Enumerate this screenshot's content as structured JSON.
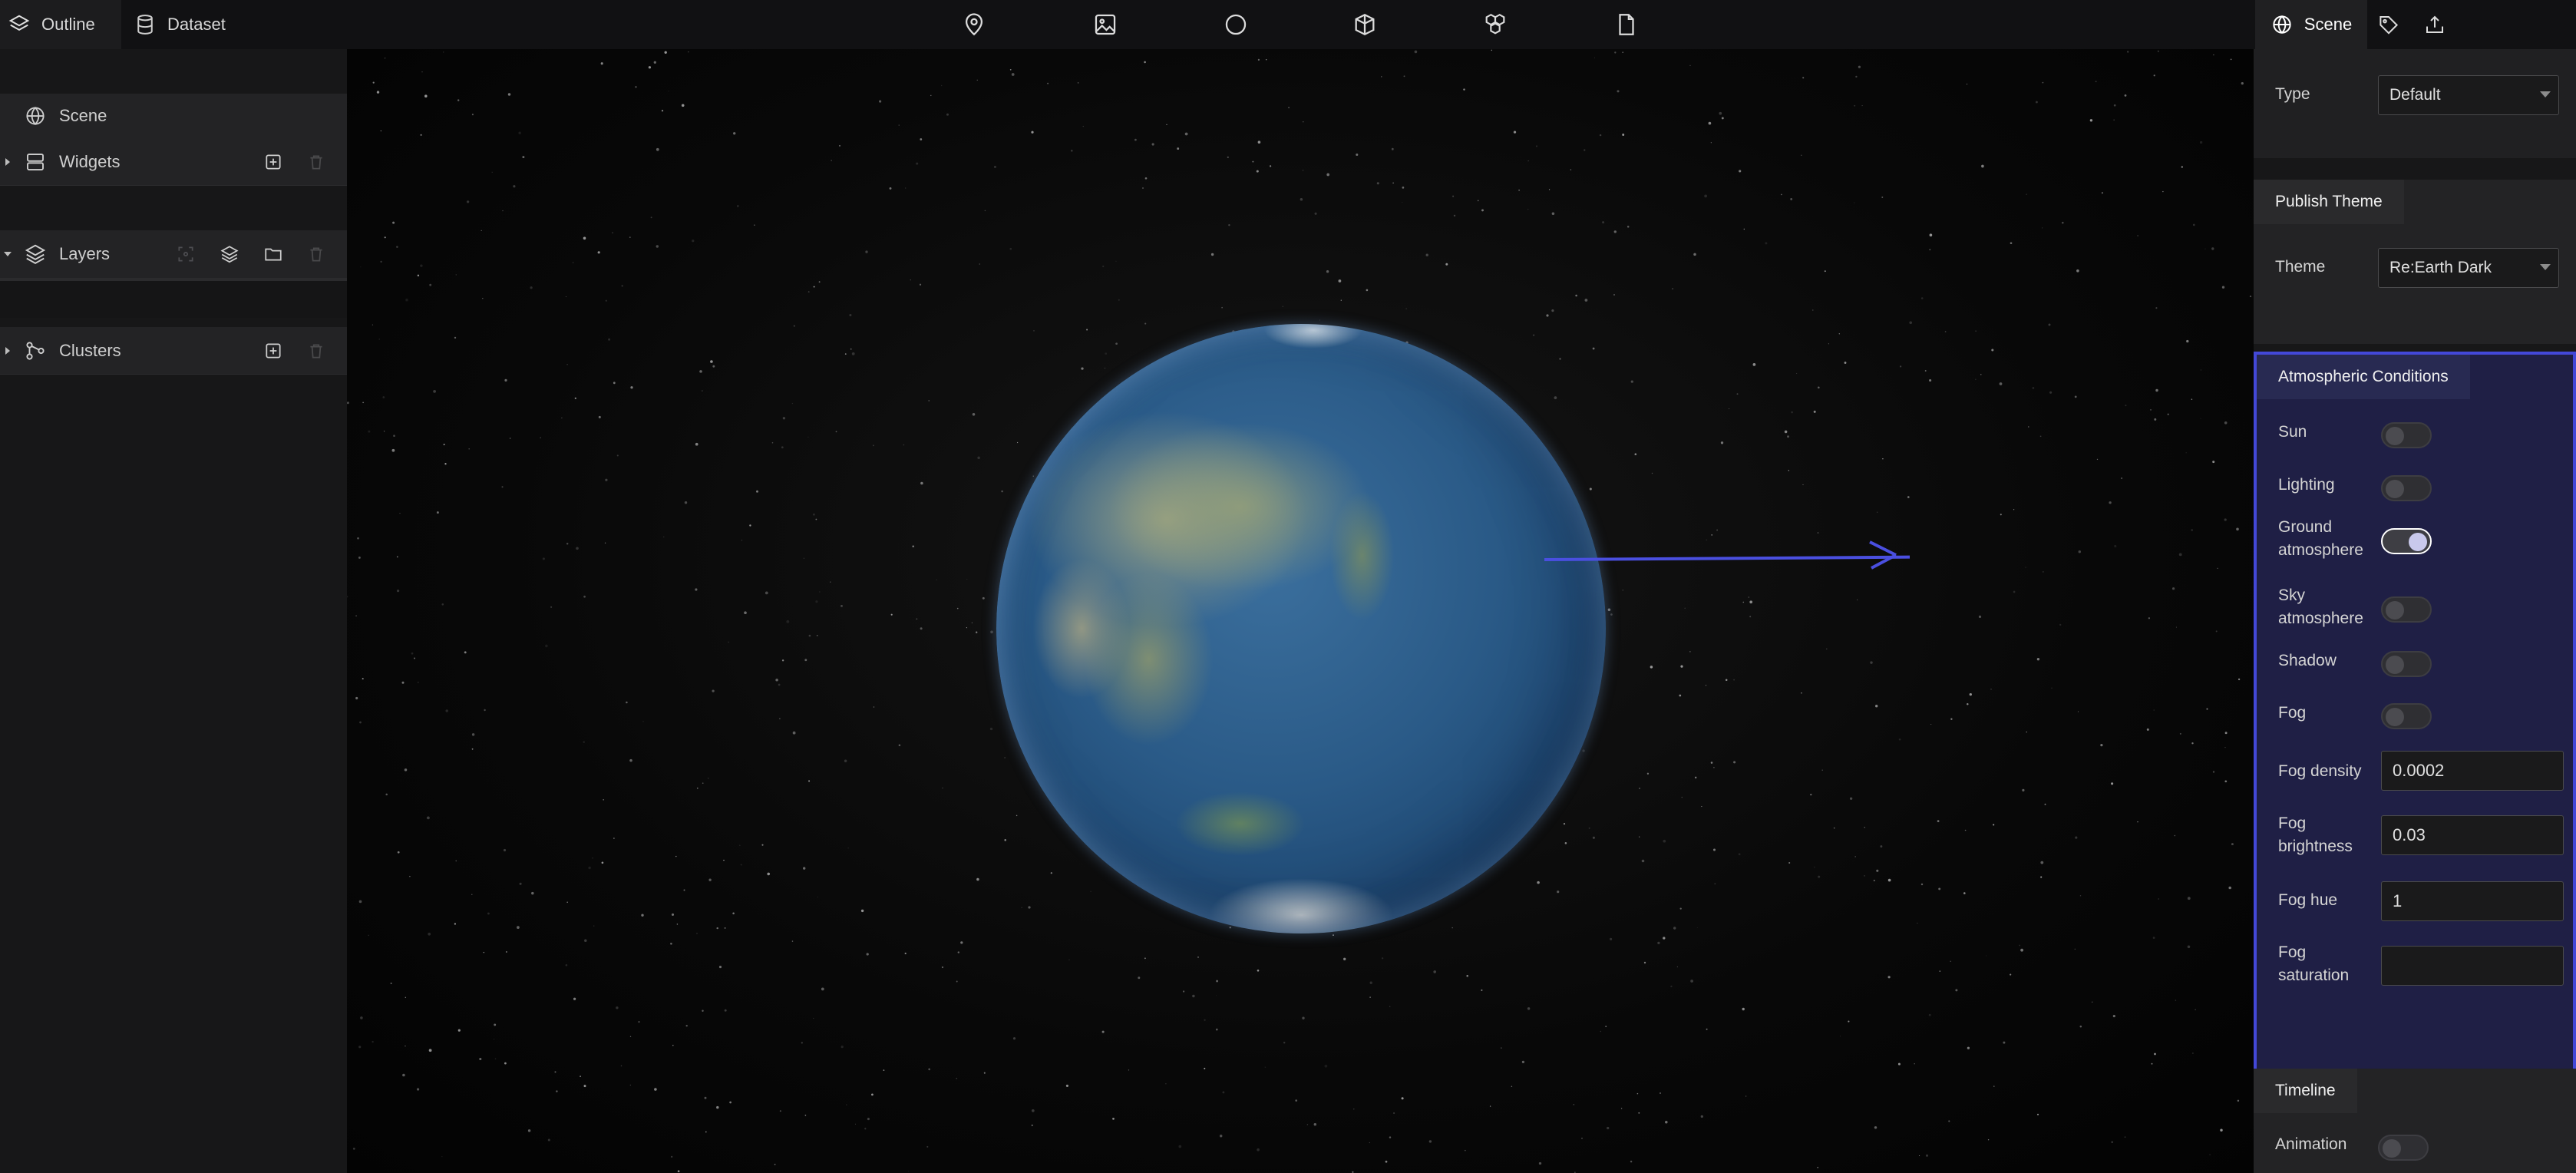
{
  "left_tabs": {
    "outline": "Outline",
    "dataset": "Dataset"
  },
  "toolbar_icons": [
    "pin-icon",
    "image-icon",
    "circle-icon",
    "cube-icon",
    "cluster-icon",
    "file-icon"
  ],
  "right_tabs": {
    "scene": "Scene"
  },
  "outline": {
    "scene": "Scene",
    "widgets": "Widgets",
    "layers": "Layers",
    "clusters": "Clusters"
  },
  "scene_settings": {
    "type_label": "Type",
    "type_value": "Default",
    "publish_theme_header": "Publish Theme",
    "theme_label": "Theme",
    "theme_value": "Re:Earth Dark",
    "atmospheric_header": "Atmospheric Conditions",
    "sun_label": "Sun",
    "sun_on": false,
    "lighting_label": "Lighting",
    "lighting_on": false,
    "ground_atmosphere_label": "Ground atmosphere",
    "ground_atmosphere_on": true,
    "sky_atmosphere_label": "Sky atmosphere",
    "sky_atmosphere_on": false,
    "shadow_label": "Shadow",
    "shadow_on": false,
    "fog_label": "Fog",
    "fog_on": false,
    "fog_density_label": "Fog density",
    "fog_density_value": "0.0002",
    "fog_brightness_label": "Fog brightness",
    "fog_brightness_value": "0.03",
    "fog_hue_label": "Fog hue",
    "fog_hue_value": "1",
    "fog_saturation_label": "Fog saturation",
    "fog_saturation_value": "",
    "timeline_header": "Timeline",
    "animation_label": "Animation",
    "animation_on": false
  },
  "colors": {
    "highlight_border": "#4348d8",
    "highlight_bg": "#1f1f45",
    "arrow": "#4a4fe0"
  }
}
